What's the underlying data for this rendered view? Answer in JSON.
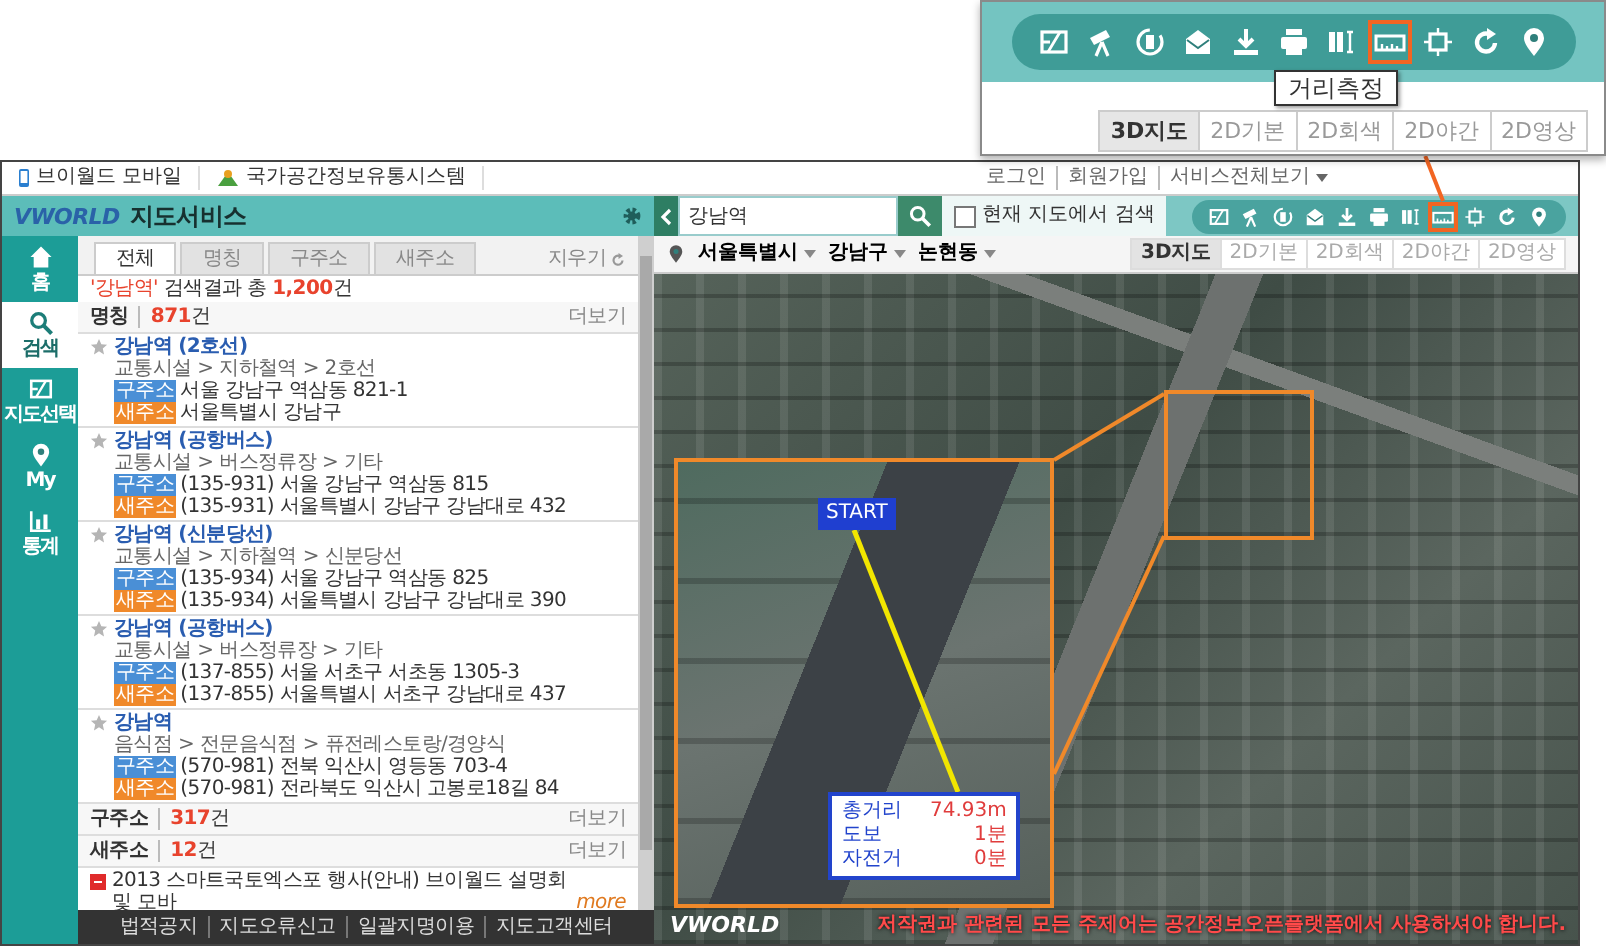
{
  "callout": {
    "tools": [
      {
        "kind": "map",
        "selected": false
      },
      {
        "kind": "telescope",
        "selected": false
      },
      {
        "kind": "rotate",
        "selected": false
      },
      {
        "kind": "mail",
        "selected": false
      },
      {
        "kind": "download",
        "selected": false
      },
      {
        "kind": "print",
        "selected": false
      },
      {
        "kind": "columns",
        "selected": false
      },
      {
        "kind": "ruler",
        "selected": true
      },
      {
        "kind": "frame",
        "selected": false
      },
      {
        "kind": "refresh",
        "selected": false
      },
      {
        "kind": "pin",
        "selected": false
      }
    ],
    "tooltip": "거리측정",
    "view_tabs": [
      {
        "label": "3D지도",
        "selected": true
      },
      {
        "label": "2D기본",
        "selected": false
      },
      {
        "label": "2D회색",
        "selected": false
      },
      {
        "label": "2D야간",
        "selected": false
      },
      {
        "label": "2D영상",
        "selected": false
      }
    ]
  },
  "top_links": [
    "브이월드 모바일",
    "국가공간정보유통시스템"
  ],
  "account_links": [
    "로그인",
    "회원가입",
    "서비스전체보기"
  ],
  "header": {
    "logo": "VWORLD",
    "title": "지도서비스"
  },
  "side_nav": [
    {
      "kind": "home",
      "label": "홈",
      "selected": false
    },
    {
      "kind": "search",
      "label": "검색",
      "selected": true
    },
    {
      "kind": "map",
      "label": "지도선택",
      "selected": false
    },
    {
      "kind": "pin",
      "label": "My",
      "selected": false
    },
    {
      "kind": "chart",
      "label": "통계",
      "selected": false
    }
  ],
  "search_tabs": [
    {
      "label": "전체",
      "selected": true
    },
    {
      "label": "명칭",
      "selected": false
    },
    {
      "label": "구주소",
      "selected": false
    },
    {
      "label": "새주소",
      "selected": false
    }
  ],
  "clear_button": "지우기",
  "summary": {
    "query": "'강남역'",
    "label": "검색결과 총",
    "count": "1,200",
    "unit": "건"
  },
  "name_section": {
    "title": "명칭",
    "count": "871",
    "unit": "건",
    "more": "더보기"
  },
  "results": [
    {
      "name": "강남역",
      "detail": "(2호선)",
      "category": "교통시설 > 지하철역 > 2호선",
      "addresses": [
        {
          "kind": "old",
          "tag": "구주소",
          "text": "서울 강남구 역삼동 821-1"
        },
        {
          "kind": "new",
          "tag": "새주소",
          "text": "서울특별시 강남구"
        }
      ]
    },
    {
      "name": "강남역",
      "detail": "(공항버스)",
      "category": "교통시설 > 버스정류장 > 기타",
      "addresses": [
        {
          "kind": "old",
          "tag": "구주소",
          "text": "(135-931) 서울 강남구 역삼동 815"
        },
        {
          "kind": "new",
          "tag": "새주소",
          "text": "(135-931) 서울특별시 강남구 강남대로 432"
        }
      ]
    },
    {
      "name": "강남역",
      "detail": "(신분당선)",
      "category": "교통시설 > 지하철역 > 신분당선",
      "addresses": [
        {
          "kind": "old",
          "tag": "구주소",
          "text": "(135-934) 서울 강남구 역삼동 825"
        },
        {
          "kind": "new",
          "tag": "새주소",
          "text": "(135-934) 서울특별시 강남구 강남대로 390"
        }
      ]
    },
    {
      "name": "강남역",
      "detail": "(공항버스)",
      "category": "교통시설 > 버스정류장 > 기타",
      "addresses": [
        {
          "kind": "old",
          "tag": "구주소",
          "text": "(137-855) 서울 서초구 서초동 1305-3"
        },
        {
          "kind": "new",
          "tag": "새주소",
          "text": "(137-855) 서울특별시 서초구 강남대로 437"
        }
      ]
    },
    {
      "name": "강남역",
      "category": "음식점 > 전문음식점 > 퓨전레스토랑/경양식",
      "addresses": [
        {
          "kind": "old",
          "tag": "구주소",
          "text": "(570-981) 전북 익산시 영등동 703-4"
        },
        {
          "kind": "new",
          "tag": "새주소",
          "text": "(570-981) 전라북도 익산시 고봉로18길 84"
        }
      ]
    }
  ],
  "other_sections": [
    {
      "title": "구주소",
      "count": "317",
      "unit": "건",
      "more": "더보기"
    },
    {
      "title": "새주소",
      "count": "12",
      "unit": "건",
      "more": "더보기"
    }
  ],
  "notice": {
    "text": "2013 스마트국토엑스포 행사(안내) 브이월드 설명회 및 모바",
    "more": "more"
  },
  "footer_links": [
    "법적공지",
    "지도오류신고",
    "일괄지명이용",
    "지도고객센터"
  ],
  "map": {
    "search_value": "강남역",
    "local_search": {
      "label": "현재 지도에서 검색",
      "checked": false
    },
    "tools": [
      {
        "kind": "map",
        "selected": false
      },
      {
        "kind": "telescope",
        "selected": false
      },
      {
        "kind": "rotate",
        "selected": false
      },
      {
        "kind": "mail",
        "selected": false
      },
      {
        "kind": "download",
        "selected": false
      },
      {
        "kind": "print",
        "selected": false
      },
      {
        "kind": "columns",
        "selected": false
      },
      {
        "kind": "ruler",
        "selected": true
      },
      {
        "kind": "frame",
        "selected": false
      },
      {
        "kind": "refresh",
        "selected": false
      },
      {
        "kind": "pin",
        "selected": false
      }
    ],
    "breadcrumb": [
      "서울특별시",
      "강남구",
      "논현동"
    ],
    "view_tabs": [
      {
        "label": "3D지도",
        "selected": true
      },
      {
        "label": "2D기본",
        "selected": false
      },
      {
        "label": "2D회색",
        "selected": false
      },
      {
        "label": "2D야간",
        "selected": false
      },
      {
        "label": "2D영상",
        "selected": false
      }
    ],
    "measure": {
      "start": "START",
      "rows": [
        {
          "label": "총거리",
          "value": "74.93m"
        },
        {
          "label": "도보",
          "value": "1분"
        },
        {
          "label": "자전거",
          "value": "0분"
        }
      ]
    },
    "logo": "VWORLD",
    "copyright": "저작권과 관련된 모든 주제어는 공간정보오픈플랫폼에서 사용하셔야 합니다."
  }
}
